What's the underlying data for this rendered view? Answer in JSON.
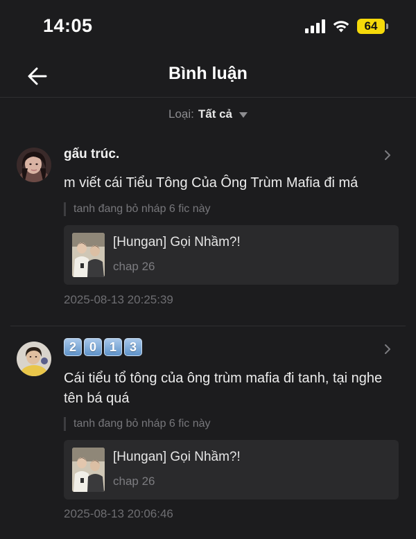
{
  "status_bar": {
    "time": "14:05",
    "battery": "64",
    "icons": [
      "signal-icon",
      "wifi-icon",
      "battery-icon"
    ]
  },
  "header": {
    "title": "Bình luận",
    "back_icon": "arrow-left-icon"
  },
  "filter": {
    "label": "Loại:",
    "value": "Tất cả"
  },
  "comments": [
    {
      "username": "gấu trúc.",
      "text": "m viết cái Tiểu Tông Của Ông Trùm Mafia đi má",
      "quote": "tanh đang bỏ nháp 6 fic này",
      "story": {
        "title": "[Hungan] Gọi Nhầm?!",
        "chapter": "chap 26"
      },
      "timestamp": "2025-08-13 20:25:39"
    },
    {
      "username_badges": [
        "2",
        "0",
        "1",
        "3"
      ],
      "text": "Cái tiểu tổ tông của ông trùm mafia đi tanh, tại nghe tên bá quá",
      "quote": "tanh đang bỏ nháp 6 fic này",
      "story": {
        "title": "[Hungan] Gọi Nhầm?!",
        "chapter": "chap 26"
      },
      "timestamp": "2025-08-13 20:06:46"
    }
  ],
  "colors": {
    "background": "#1c1c1e",
    "card": "#2a2a2c",
    "battery": "#f5d90a",
    "badge": "#6c9fd2"
  }
}
